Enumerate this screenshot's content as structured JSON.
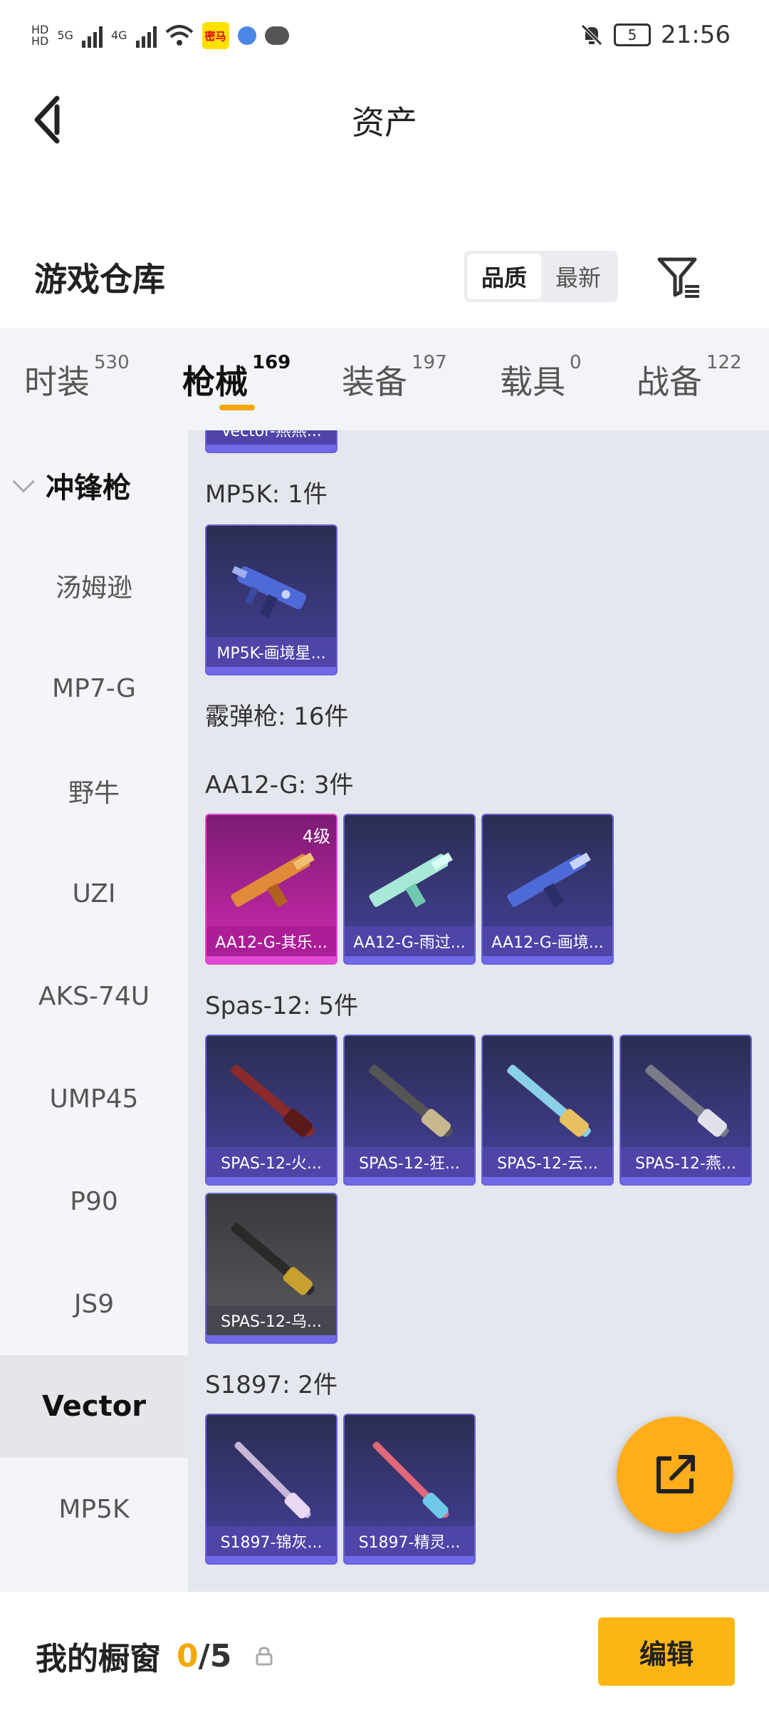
{
  "status_bar": {
    "time": "21:56",
    "battery": "5",
    "net_1": "5G",
    "net_2": "4G",
    "app_badge": "密马"
  },
  "nav": {
    "title": "资产"
  },
  "warehouse": {
    "title": "游戏仓库",
    "sort_options": [
      "品质",
      "最新"
    ],
    "sort_selected": "品质"
  },
  "tabs": [
    {
      "label": "时装",
      "count": "530"
    },
    {
      "label": "枪械",
      "count": "169",
      "active": true
    },
    {
      "label": "装备",
      "count": "197"
    },
    {
      "label": "载具",
      "count": "0"
    },
    {
      "label": "战备",
      "count": "122"
    }
  ],
  "sidebar": {
    "group": "冲锋枪",
    "items": [
      "汤姆逊",
      "MP7-G",
      "野牛",
      "UZI",
      "AKS-74U",
      "UMP45",
      "P90",
      "JS9",
      "Vector",
      "MP5K"
    ],
    "active": "Vector"
  },
  "content": {
    "partial_card": "Vector-燕燕...",
    "mp5k_title": "MP5K: 1件",
    "mp5k_items": [
      "MP5K-画境星..."
    ],
    "shotgun_title": "霰弹枪: 16件",
    "aa12_title": "AA12-G: 3件",
    "aa12_items": [
      "AA12-G-其乐...",
      "AA12-G-雨过...",
      "AA12-G-画境..."
    ],
    "aa12_level": "4级",
    "spas_title": "Spas-12: 5件",
    "spas_items": [
      "SPAS-12-火...",
      "SPAS-12-狂...",
      "SPAS-12-云...",
      "SPAS-12-燕...",
      "SPAS-12-乌..."
    ],
    "s1897_title": "S1897: 2件",
    "s1897_items": [
      "S1897-锦灰...",
      "S1897-精灵..."
    ]
  },
  "bottom": {
    "showcase_label": "我的橱窗",
    "count_current": "0",
    "count_sep": "/",
    "count_total": "5",
    "edit_label": "编辑"
  },
  "colors": {
    "accent": "#fcb614",
    "fab": "#ffad1a",
    "card_purple": "#3e3b86",
    "card_pink": "#b8269e"
  }
}
